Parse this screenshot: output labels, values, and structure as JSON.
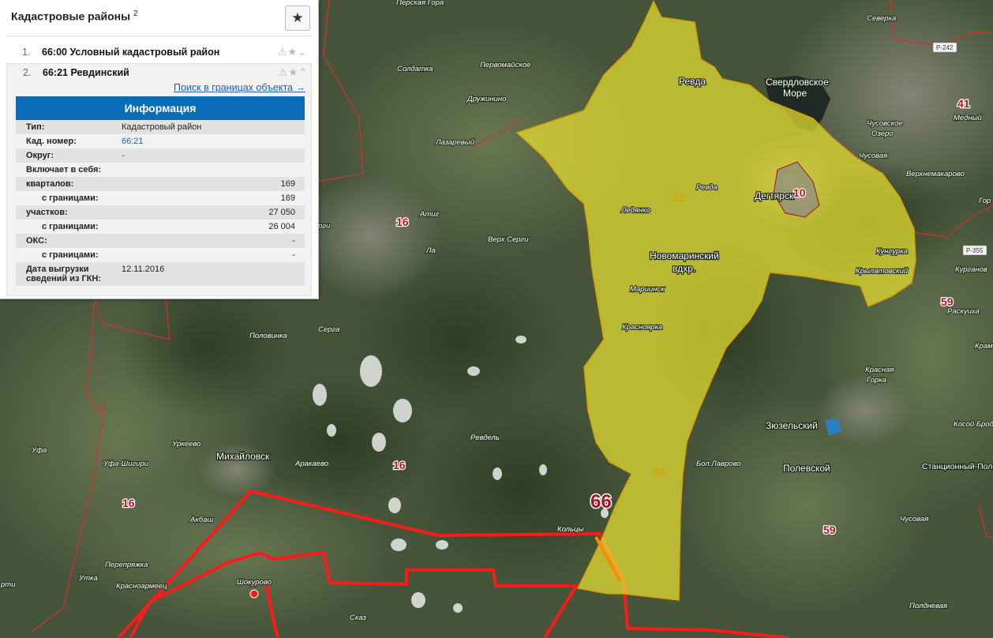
{
  "panel": {
    "title": "Кадастровые районы",
    "title_count": "2",
    "fav_button_icon": "star-icon",
    "results": [
      {
        "num": "1.",
        "name": "66:00 Условный кадастровый район"
      },
      {
        "num": "2.",
        "name": "66:21 Ревдинский"
      }
    ],
    "search_link": "Поиск в границах объекта →",
    "info": {
      "header": "Информация",
      "type_label": "Тип:",
      "type_value": "Кадастровый район",
      "cad_label": "Кад. номер:",
      "cad_value": "66:21",
      "okrug_label": "Округ:",
      "okrug_value": "-",
      "includes_label": "Включает в себя:",
      "kvartalov_label": "кварталов:",
      "kvartalov_value": "169",
      "kv_bound_label": "с границами:",
      "kv_bound_value": "169",
      "uchastkov_label": "участков:",
      "uchastkov_value": "27 050",
      "uch_bound_label": "с границами:",
      "uch_bound_value": "26 004",
      "oks_label": "ОКС:",
      "oks_value": "-",
      "oks_bound_label": "с границами:",
      "oks_bound_value": "-",
      "date_label_1": "Дата выгрузки",
      "date_label_2": "сведений из ГКН:",
      "date_value": "12.11.2016"
    }
  },
  "map": {
    "colors": {
      "forest": "#3f4d30",
      "highlight": "#e8e030",
      "boundary": "#ff1a1a",
      "district_line": "#d43030"
    },
    "region_number": "66",
    "district_numbers": {
      "d21a": "21",
      "d21b": "21",
      "d16a": "16",
      "d16b": "16",
      "d16c": "16",
      "d41": "41",
      "d59a": "59",
      "d59b": "59",
      "d10": "10"
    },
    "road_badges": {
      "r242": "Р-242",
      "r355": "Р-355"
    },
    "towns": {
      "revda": "Ревда",
      "degtyarsk": "Дегтярск",
      "mikhailovsk": "Михайловск",
      "polevskoy": "Полевской",
      "sverdl1": "Свердловское",
      "sverdl2": "Море",
      "novomar1": "Новомаринский",
      "novomar2": "вдхр.",
      "zyuzelsky": "Зюзельский",
      "stantsionny": "Станционный-Полевской"
    },
    "places": {
      "perskaya": "Перская Гора",
      "sever": "Северка",
      "soldatka": "Солдатка",
      "pervomaiskoe": "Первомайское",
      "drugzhinino": "Дружинино",
      "lazarevsky": "Лазаревый",
      "ledyanka": "Ледянко",
      "mariinsk": "Мариинск",
      "krasnoyar": "Красноярка",
      "kunguruka": "Кунгурка",
      "krylatovsky": "Крылатовский",
      "chusovskoe1": "Чусовское",
      "chusovskoe2": "Озеро",
      "verkhnemakarovo": "Верхнемакарово",
      "mednyi": "Медный",
      "atig": "Атиг",
      "verkh_sergi": "Верх.Серги",
      "polovinka": "Половинка",
      "revdel": "Ревдель",
      "urikeevo": "Уркеево",
      "ufa_shigiri": "Уфа-Шигири",
      "arakaevo": "Аракаево",
      "akbash": "Акбаш",
      "perepryazhka": "Перепряжка",
      "krasnoyarovets": "Красноармеец",
      "shokurovo": "Шокурово",
      "skaz": "Сказ",
      "koltsy": "Кольцы",
      "bol_lavrovo": "Бол.Лаврово",
      "krasnaya1": "Красная",
      "krasnaya2": "Горка",
      "kosoi_brod": "Косой Брод",
      "poldnevaya": "Полдневая",
      "raskuha": "Раскуиха",
      "ufa": "Уфа",
      "utka": "Утка",
      "chusovaya": "Чусовая",
      "revda_river": "Ревда",
      "serga": "Серга",
      "chusovaya2": "Чусовая",
      "gor": "Гор",
      "arti": "рти",
      "kram": "Крам",
      "kurgan": "Курганов",
      "prorgi": "рги",
      "lg": "Ла"
    }
  }
}
